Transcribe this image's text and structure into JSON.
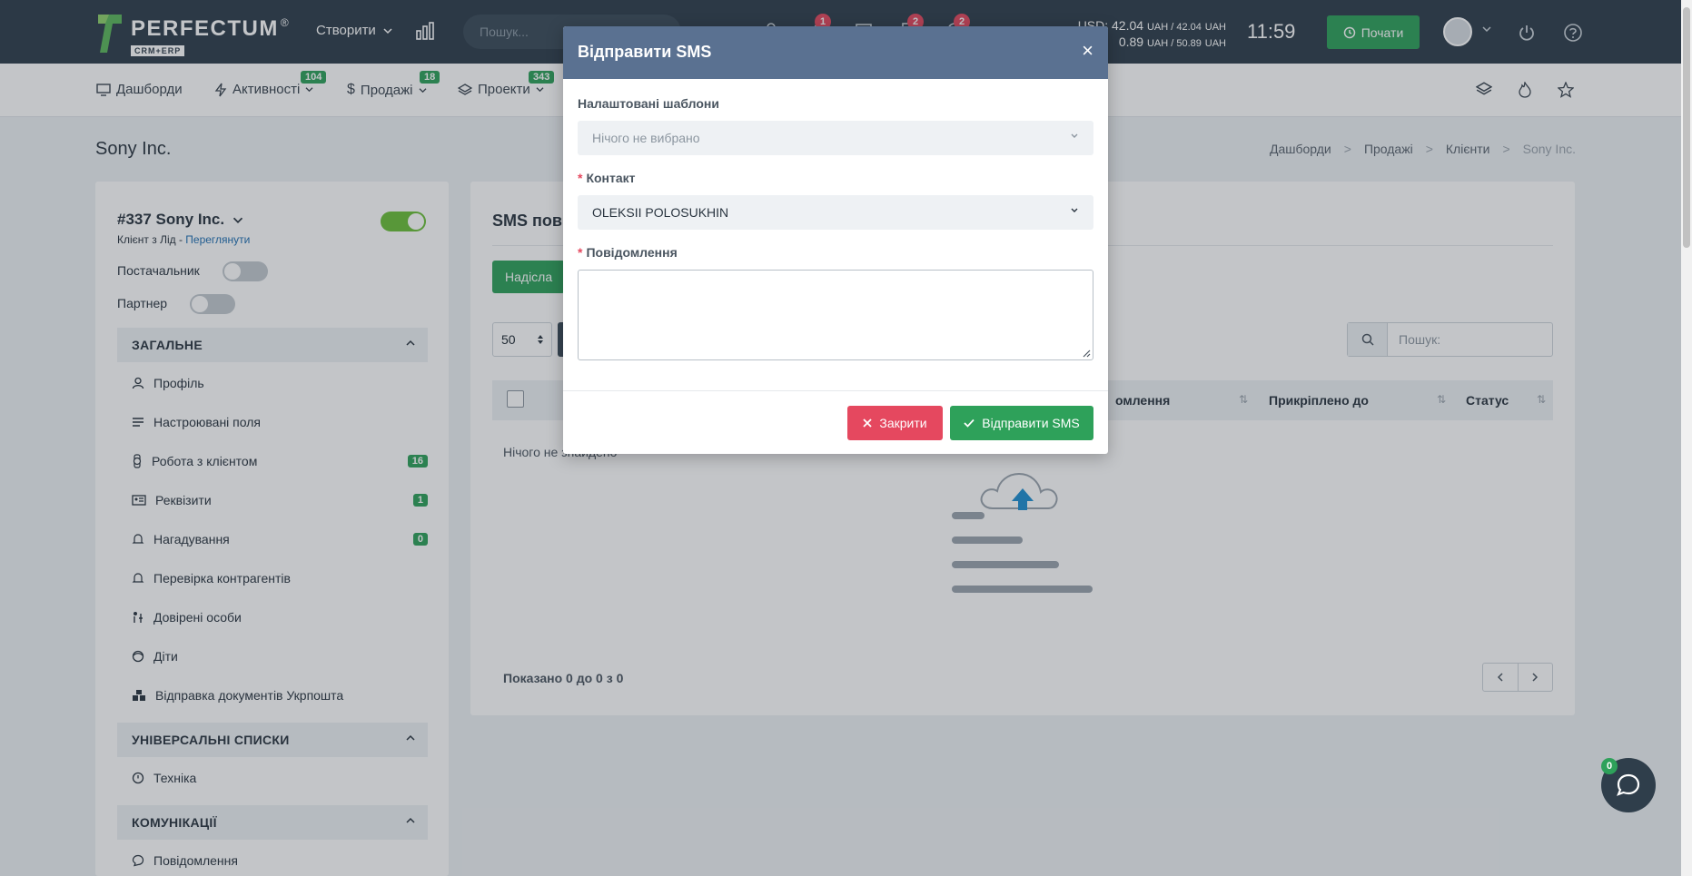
{
  "header": {
    "logo_name": "PERFECTUM",
    "logo_reg": "®",
    "logo_sub": "CRM+ERP",
    "create_label": "Створити",
    "search_placeholder": "Пошук...",
    "badges": [
      "1",
      "2",
      "2"
    ],
    "currency_line1": "USD: 42.04",
    "currency_line1_unit": "UAH / 42.04",
    "currency_line1_unit2": "UAH",
    "currency_line2": "0.89",
    "currency_line2_unit": "UAH / 50.89",
    "currency_line2_unit2": "UAH",
    "clock": "11:59",
    "start_label": "Почати"
  },
  "nav": {
    "items": [
      {
        "label": "Дашборди",
        "badge": ""
      },
      {
        "label": "Активності",
        "badge": "104"
      },
      {
        "label": "Продажі",
        "badge": "18"
      },
      {
        "label": "Проекти",
        "badge": "343"
      }
    ]
  },
  "page": {
    "title": "Sony Inc.",
    "breadcrumb": [
      "Дашборди",
      "Продажі",
      "Клієнти",
      "Sony Inc."
    ],
    "breadcrumb_sep": ">"
  },
  "client": {
    "title": "#337 Sony Inc.",
    "sub_prefix": "Клієнт з Лід - ",
    "sub_link": "Переглянути",
    "supplier_label": "Постачальник",
    "partner_label": "Партнер",
    "sections": [
      {
        "title": "ЗАГАЛЬНЕ",
        "items": [
          {
            "label": "Профіль",
            "badge": "",
            "icon": "user-icon"
          },
          {
            "label": "Настроювані поля",
            "badge": "",
            "icon": "lines-icon"
          },
          {
            "label": "Робота з клієнтом",
            "badge": "16",
            "icon": "watch-icon"
          },
          {
            "label": "Реквізити",
            "badge": "1",
            "icon": "id-card-icon"
          },
          {
            "label": "Нагадування",
            "badge": "0",
            "icon": "bell-icon"
          },
          {
            "label": "Перевірка контрагентів",
            "badge": "",
            "icon": "bell-icon"
          },
          {
            "label": "Довірені особи",
            "badge": "",
            "icon": "people-icon"
          },
          {
            "label": "Діти",
            "badge": "",
            "icon": "child-icon"
          },
          {
            "label": "Відправка документів Укрпошта",
            "badge": "",
            "icon": "boxes-icon"
          }
        ]
      },
      {
        "title": "УНІВЕРСАЛЬНІ СПИСКИ",
        "items": [
          {
            "label": "Техніка",
            "badge": "",
            "icon": "clock-icon"
          }
        ]
      },
      {
        "title": "КОМУНІКАЦІЇ",
        "items": [
          {
            "label": "Повідомлення",
            "badge": "",
            "icon": "chat-icon"
          }
        ]
      }
    ]
  },
  "main": {
    "title": "SMS пові",
    "send_label": "Надісла",
    "per_page": "50",
    "search_placeholder": "Пошук:",
    "columns": [
      "омлення",
      "Прикріплено до",
      "Статус"
    ],
    "empty": "Нічого не знайдено",
    "shown": "Показано 0 до 0 з 0"
  },
  "modal": {
    "title": "Відправити SMS",
    "close_symbol": "×",
    "template_label": "Налаштовані шаблони",
    "template_placeholder": "Нічого не вибрано",
    "contact_label": "Контакт",
    "contact_value": "OLEKSII POLOSUKHIN",
    "message_label": "Повідомлення",
    "required_mark": "*",
    "close_label": "Закрити",
    "send_label": "Відправити SMS"
  },
  "chat": {
    "badge": "0"
  },
  "colors": {
    "header_bg": "#2f3e4b",
    "accent_green": "#2ea15a",
    "danger_red": "#e5485f",
    "modal_header": "#5a7191"
  }
}
